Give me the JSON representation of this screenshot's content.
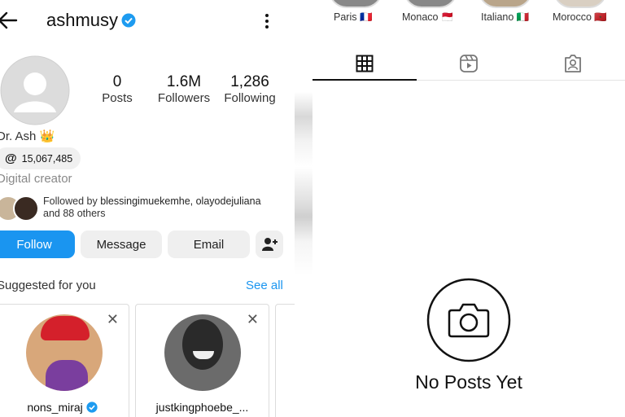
{
  "profile": {
    "username": "ashmusy",
    "display_name": "Dr. Ash 👑",
    "threads_count": "15,067,485",
    "category": "Digital creator",
    "followed_by_prefix": "Followed by ",
    "followed_by_names": "blessingimuekemhe, olayodejuliana",
    "followed_by_others": "and 88 others"
  },
  "stats": {
    "posts_value": "0",
    "posts_label": "Posts",
    "followers_value": "1.6M",
    "followers_label": "Followers",
    "following_value": "1,286",
    "following_label": "Following"
  },
  "buttons": {
    "follow": "Follow",
    "message": "Message",
    "email": "Email"
  },
  "suggested": {
    "title": "Suggested for you",
    "see_all": "See all",
    "cards": [
      {
        "username": "nons_miraj"
      },
      {
        "username": "justkingphoebe_..."
      }
    ]
  },
  "highlights": [
    {
      "label": "Paris 🇫🇷"
    },
    {
      "label": "Monaco 🇲🇨"
    },
    {
      "label": "Italiano 🇮🇹"
    },
    {
      "label": "Morocco 🇲🇦"
    }
  ],
  "empty_state": {
    "text": "No Posts Yet"
  },
  "colors": {
    "accent": "#1a95f0",
    "verified": "#1d9bf0"
  }
}
